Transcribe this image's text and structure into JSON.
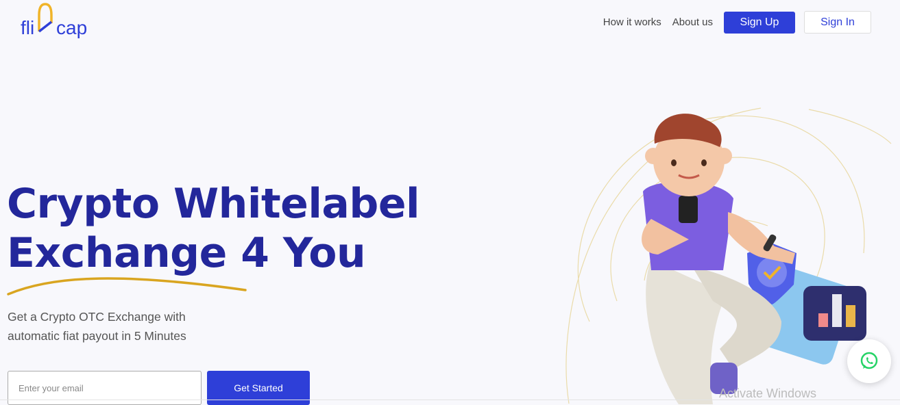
{
  "logo": {
    "text_left": "fli",
    "text_right": "cap",
    "accent_color": "#f0b429",
    "brand_color": "#2e3fd8"
  },
  "nav": {
    "how_it_works": "How it works",
    "about_us": "About us",
    "sign_up": "Sign Up",
    "sign_in": "Sign In"
  },
  "hero": {
    "headline_line1": "Crypto Whitelabel",
    "headline_line2": "Exchange 4 You",
    "subtext": "Get a Crypto OTC Exchange with automatic fiat payout in 5 Minutes",
    "email_placeholder": "Enter your email",
    "cta_label": "Get Started"
  },
  "overlay": {
    "watermark": "Activate Windows",
    "whatsapp_icon": "whatsapp-icon"
  },
  "colors": {
    "headline": "#23279b",
    "primary": "#2e3fd8",
    "underline": "#d9a520",
    "background": "#f8f8fc"
  }
}
